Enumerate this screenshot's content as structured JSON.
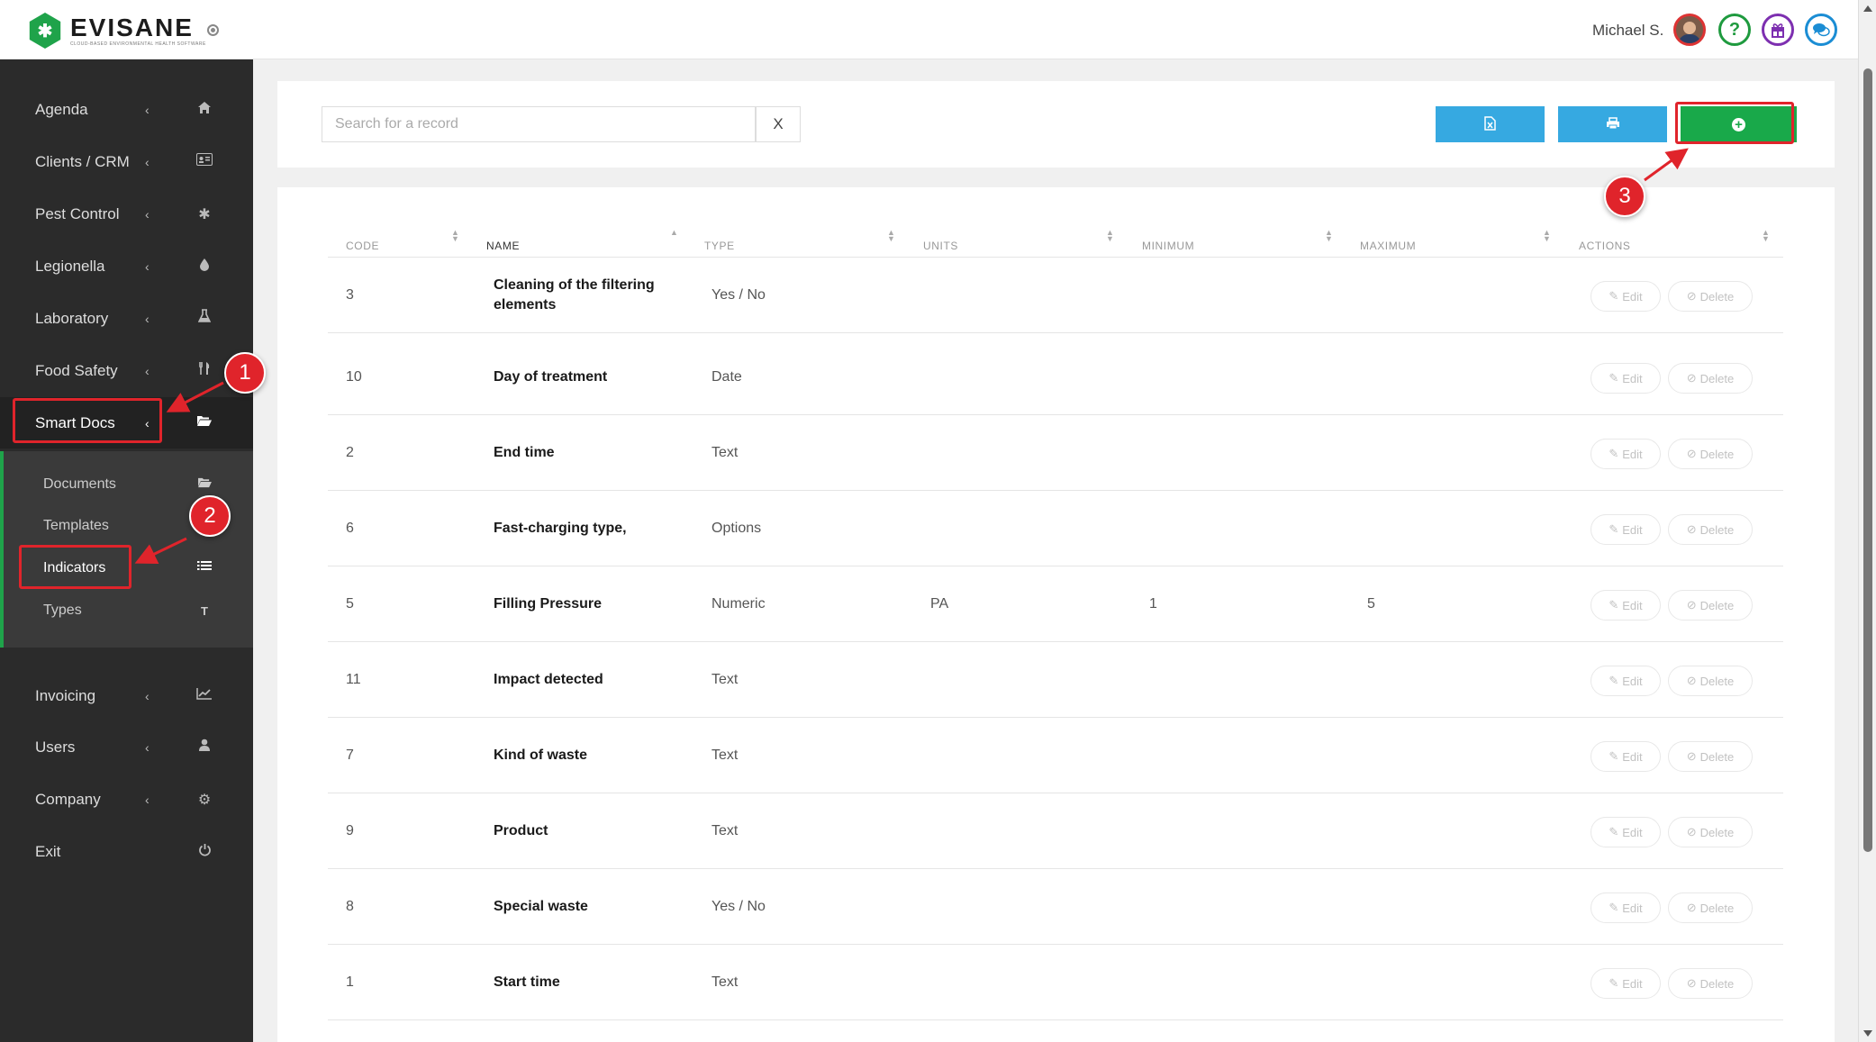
{
  "header": {
    "logo_text": "EVISANE",
    "logo_subtitle": "CLOUD-BASED ENVIRONMENTAL HEALTH SOFTWARE",
    "user_name": "Michael S.",
    "icons": [
      "collapse-icon",
      "avatar",
      "help-icon",
      "gift-icon",
      "chat-icon"
    ]
  },
  "sidebar": {
    "items": [
      {
        "label": "Agenda",
        "icon": "home-icon"
      },
      {
        "label": "Clients / CRM",
        "icon": "id-card-icon"
      },
      {
        "label": "Pest Control",
        "icon": "bug-icon"
      },
      {
        "label": "Legionella",
        "icon": "drop-icon"
      },
      {
        "label": "Laboratory",
        "icon": "flask-icon"
      },
      {
        "label": "Food Safety",
        "icon": "cutlery-icon"
      },
      {
        "label": "Smart Docs",
        "icon": "folder-open-icon"
      },
      {
        "label": "Invoicing",
        "icon": "chart-line-icon"
      },
      {
        "label": "Users",
        "icon": "user-icon"
      },
      {
        "label": "Company",
        "icon": "gear-icon"
      },
      {
        "label": "Exit",
        "icon": "power-icon"
      }
    ],
    "submenu": [
      {
        "label": "Documents",
        "icon": "folder-open-icon"
      },
      {
        "label": "Templates",
        "icon": ""
      },
      {
        "label": "Indicators",
        "icon": "list-icon"
      },
      {
        "label": "Types",
        "icon": "text-icon"
      }
    ],
    "type_icon_glyph": "T"
  },
  "toolbar": {
    "search_placeholder": "Search for a record",
    "search_value": "",
    "clear_label": "X"
  },
  "table": {
    "columns": [
      "CODE",
      "NAME",
      "TYPE",
      "UNITS",
      "MINIMUM",
      "MAXIMUM",
      "ACTIONS"
    ],
    "rows": [
      {
        "code": "3",
        "name": "Cleaning of the filtering elements",
        "type": "Yes / No",
        "units": "",
        "min": "",
        "max": ""
      },
      {
        "code": "10",
        "name": "Day of treatment",
        "type": "Date",
        "units": "",
        "min": "",
        "max": ""
      },
      {
        "code": "2",
        "name": "End time",
        "type": "Text",
        "units": "",
        "min": "",
        "max": ""
      },
      {
        "code": "6",
        "name": "Fast-charging type,",
        "type": "Options",
        "units": "",
        "min": "",
        "max": ""
      },
      {
        "code": "5",
        "name": "Filling Pressure",
        "type": "Numeric",
        "units": "PA",
        "min": "1",
        "max": "5"
      },
      {
        "code": "11",
        "name": "Impact detected",
        "type": "Text",
        "units": "",
        "min": "",
        "max": ""
      },
      {
        "code": "7",
        "name": "Kind of waste",
        "type": "Text",
        "units": "",
        "min": "",
        "max": ""
      },
      {
        "code": "9",
        "name": "Product",
        "type": "Text",
        "units": "",
        "min": "",
        "max": ""
      },
      {
        "code": "8",
        "name": "Special waste",
        "type": "Yes / No",
        "units": "",
        "min": "",
        "max": ""
      },
      {
        "code": "1",
        "name": "Start time",
        "type": "Text",
        "units": "",
        "min": "",
        "max": ""
      }
    ],
    "edit_label": "Edit",
    "delete_label": "Delete"
  },
  "annotations": {
    "labels": [
      "1",
      "2",
      "3"
    ],
    "color": "#e0242b"
  },
  "colors": {
    "sidebar_bg": "#2b2b2b",
    "accent_green": "#19a94a",
    "button_blue": "#36a9e1"
  }
}
